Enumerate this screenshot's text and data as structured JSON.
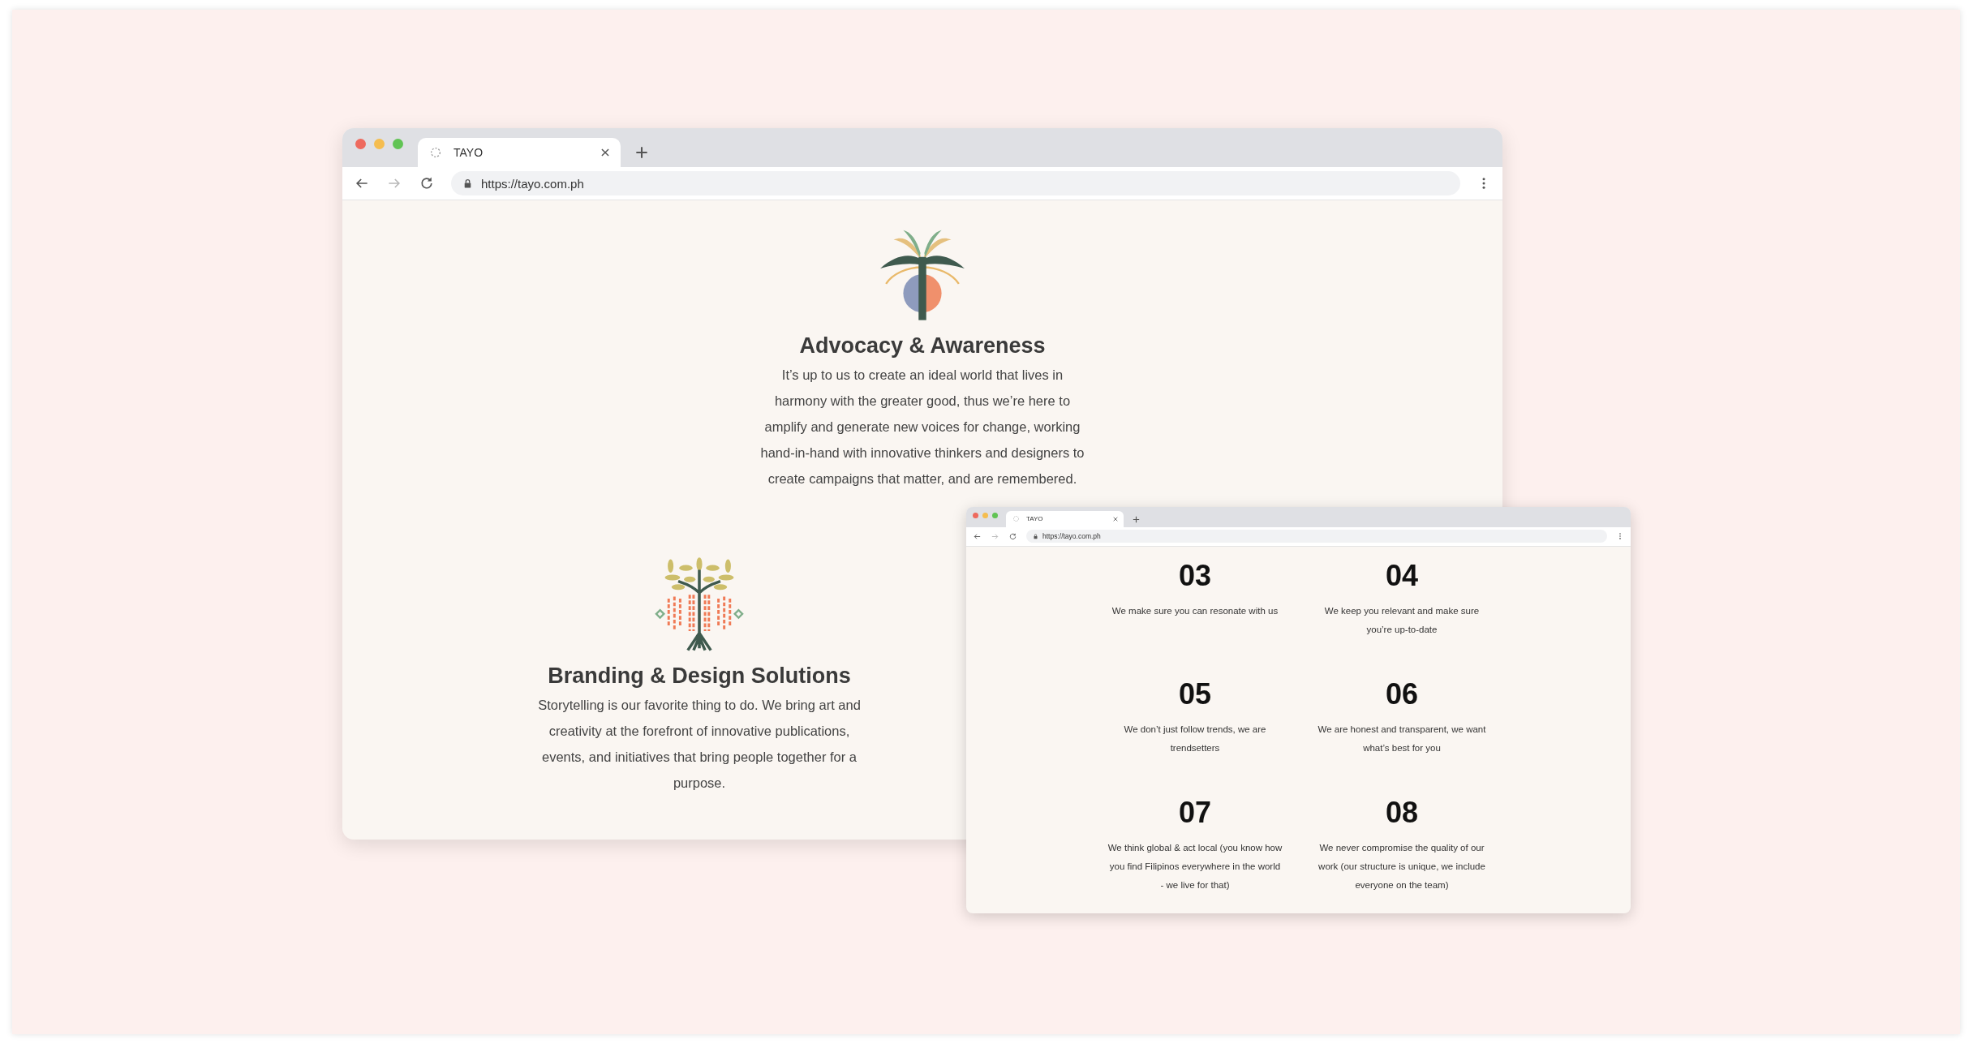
{
  "windows": [
    {
      "kind": "main",
      "tab": {
        "title": "TAYO",
        "selected": true
      },
      "nav": [
        {
          "kind": "back",
          "disabled": false
        },
        {
          "kind": "forward",
          "disabled": true
        },
        {
          "kind": "reload",
          "disabled": false
        }
      ],
      "url": "https://tayo.com.ph",
      "sections": [
        {
          "kind": "palm",
          "title": "Advocacy & Awareness",
          "text": "It’s up to us to create an ideal world that lives in harmony with the greater good, thus we’re here to amplify and generate new voices for change, working hand-in-hand with innovative thinkers and designers to create campaigns that matter, and are remembered."
        },
        {
          "kind": "tree",
          "title": "Branding & Design Solutions",
          "text": "Storytelling is our favorite thing to do. We bring art and creativity at the forefront of innovative publications, events, and initiatives that bring people together for a purpose."
        }
      ]
    },
    {
      "kind": "inset",
      "tab": {
        "title": "TAYO",
        "selected": true
      },
      "nav": [
        {
          "kind": "back",
          "disabled": false
        },
        {
          "kind": "forward",
          "disabled": true
        },
        {
          "kind": "reload",
          "disabled": false
        }
      ],
      "url": "https://tayo.com.ph",
      "items": [
        {
          "number": "03",
          "text": "We make sure you can resonate with us"
        },
        {
          "number": "04",
          "text": "We keep you relevant and make sure you’re up-to-date"
        },
        {
          "number": "05",
          "text": "We don’t just follow trends, we are trendsetters"
        },
        {
          "number": "06",
          "text": "We are honest and transparent, we want what’s best for you"
        },
        {
          "number": "07",
          "text": "We think global & act local (you know how you find Filipinos everywhere in the world - we live for that)"
        },
        {
          "number": "08",
          "text": "We never compromise the quality of our work (our structure is unique, we include everyone on the team)"
        }
      ]
    }
  ]
}
